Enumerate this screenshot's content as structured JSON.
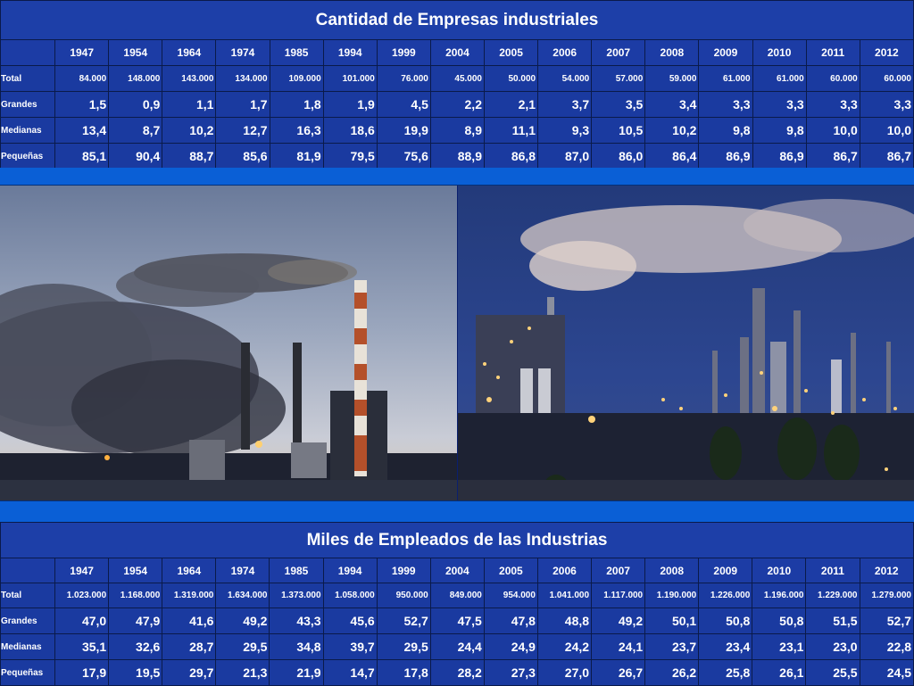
{
  "companies_table": {
    "title": "Cantidad de Empresas industriales",
    "years": [
      "1947",
      "1954",
      "1964",
      "1974",
      "1985",
      "1994",
      "1999",
      "2004",
      "2005",
      "2006",
      "2007",
      "2008",
      "2009",
      "2010",
      "2011",
      "2012"
    ],
    "rows": [
      {
        "label": "Total",
        "kind": "total",
        "values": [
          "84.000",
          "148.000",
          "143.000",
          "134.000",
          "109.000",
          "101.000",
          "76.000",
          "45.000",
          "50.000",
          "54.000",
          "57.000",
          "59.000",
          "61.000",
          "61.000",
          "60.000",
          "60.000"
        ]
      },
      {
        "label": "Grandes",
        "kind": "pct",
        "values": [
          "1,5",
          "0,9",
          "1,1",
          "1,7",
          "1,8",
          "1,9",
          "4,5",
          "2,2",
          "2,1",
          "3,7",
          "3,5",
          "3,4",
          "3,3",
          "3,3",
          "3,3",
          "3,3"
        ]
      },
      {
        "label": "Medianas",
        "kind": "pct",
        "values": [
          "13,4",
          "8,7",
          "10,2",
          "12,7",
          "16,3",
          "18,6",
          "19,9",
          "8,9",
          "11,1",
          "9,3",
          "10,5",
          "10,2",
          "9,8",
          "9,8",
          "10,0",
          "10,0"
        ]
      },
      {
        "label": "Pequeñas",
        "kind": "pct",
        "values": [
          "85,1",
          "90,4",
          "88,7",
          "85,6",
          "81,9",
          "79,5",
          "75,6",
          "88,9",
          "86,8",
          "87,0",
          "86,0",
          "86,4",
          "86,9",
          "86,9",
          "86,7",
          "86,7"
        ]
      }
    ]
  },
  "employees_table": {
    "title": "Miles de Empleados de las Industrias",
    "years": [
      "1947",
      "1954",
      "1964",
      "1974",
      "1985",
      "1994",
      "1999",
      "2004",
      "2005",
      "2006",
      "2007",
      "2008",
      "2009",
      "2010",
      "2011",
      "2012"
    ],
    "rows": [
      {
        "label": "Total",
        "kind": "total",
        "values": [
          "1.023.000",
          "1.168.000",
          "1.319.000",
          "1.634.000",
          "1.373.000",
          "1.058.000",
          "950.000",
          "849.000",
          "954.000",
          "1.041.000",
          "1.117.000",
          "1.190.000",
          "1.226.000",
          "1.196.000",
          "1.229.000",
          "1.279.000"
        ]
      },
      {
        "label": "Grandes",
        "kind": "pct",
        "values": [
          "47,0",
          "47,9",
          "41,6",
          "49,2",
          "43,3",
          "45,6",
          "52,7",
          "47,5",
          "47,8",
          "48,8",
          "49,2",
          "50,1",
          "50,8",
          "50,8",
          "51,5",
          "52,7"
        ]
      },
      {
        "label": "Medianas",
        "kind": "pct",
        "values": [
          "35,1",
          "32,6",
          "28,7",
          "29,5",
          "34,8",
          "39,7",
          "29,5",
          "24,4",
          "24,9",
          "24,2",
          "24,1",
          "23,7",
          "23,4",
          "23,1",
          "23,0",
          "22,8"
        ]
      },
      {
        "label": "Pequeñas",
        "kind": "pct",
        "values": [
          "17,9",
          "19,5",
          "29,7",
          "21,3",
          "21,9",
          "14,7",
          "17,8",
          "28,2",
          "27,3",
          "27,0",
          "26,7",
          "26,2",
          "25,8",
          "26,1",
          "25,5",
          "24,5"
        ]
      }
    ]
  },
  "colors": {
    "background": "#0a1f6e",
    "table_fill": "#1a3aa0",
    "stripe": "#0a5fd6",
    "text": "#ffffff"
  }
}
